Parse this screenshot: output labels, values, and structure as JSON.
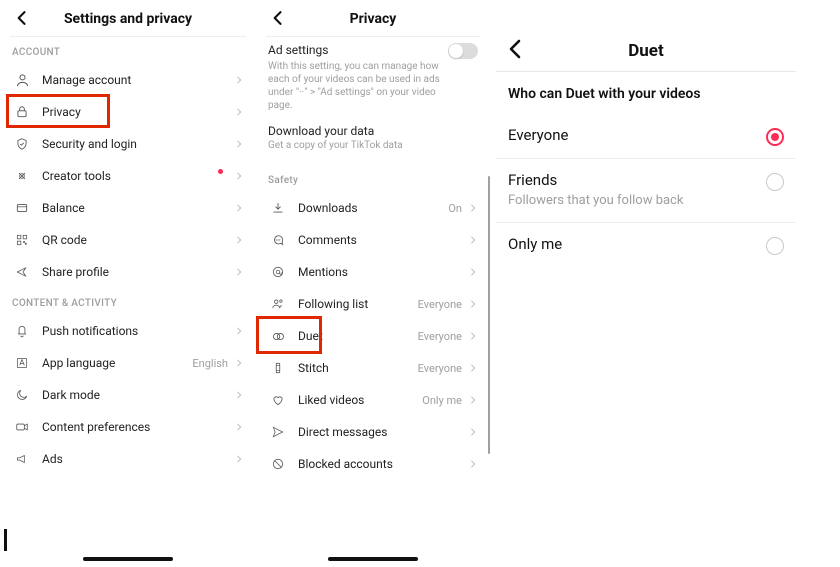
{
  "panel1": {
    "title": "Settings and privacy",
    "sections": {
      "account": {
        "label": "ACCOUNT",
        "items": [
          {
            "label": "Manage account"
          },
          {
            "label": "Privacy"
          },
          {
            "label": "Security and login"
          },
          {
            "label": "Creator tools"
          },
          {
            "label": "Balance"
          },
          {
            "label": "QR code"
          },
          {
            "label": "Share profile"
          }
        ]
      },
      "content": {
        "label": "CONTENT & ACTIVITY",
        "items": [
          {
            "label": "Push notifications"
          },
          {
            "label": "App language",
            "value": "English"
          },
          {
            "label": "Dark mode"
          },
          {
            "label": "Content preferences"
          },
          {
            "label": "Ads"
          }
        ]
      }
    }
  },
  "panel2": {
    "title": "Privacy",
    "ad_settings": {
      "title": "Ad settings",
      "desc": "With this setting, you can manage how each of your videos can be used in ads under \"··\" > \"Ad settings\" on your video page."
    },
    "download": {
      "title": "Download your data",
      "desc": "Get a copy of your TikTok data"
    },
    "safety": {
      "label": "Safety",
      "items": [
        {
          "label": "Downloads",
          "value": "On"
        },
        {
          "label": "Comments",
          "value": ""
        },
        {
          "label": "Mentions",
          "value": ""
        },
        {
          "label": "Following list",
          "value": "Everyone"
        },
        {
          "label": "Duet",
          "value": "Everyone"
        },
        {
          "label": "Stitch",
          "value": "Everyone"
        },
        {
          "label": "Liked videos",
          "value": "Only me"
        },
        {
          "label": "Direct messages",
          "value": ""
        },
        {
          "label": "Blocked accounts",
          "value": ""
        }
      ]
    }
  },
  "panel3": {
    "title": "Duet",
    "question": "Who can Duet with your videos",
    "options": [
      {
        "label": "Everyone",
        "sub": "",
        "selected": true
      },
      {
        "label": "Friends",
        "sub": "Followers that you follow back",
        "selected": false
      },
      {
        "label": "Only me",
        "sub": "",
        "selected": false
      }
    ]
  }
}
